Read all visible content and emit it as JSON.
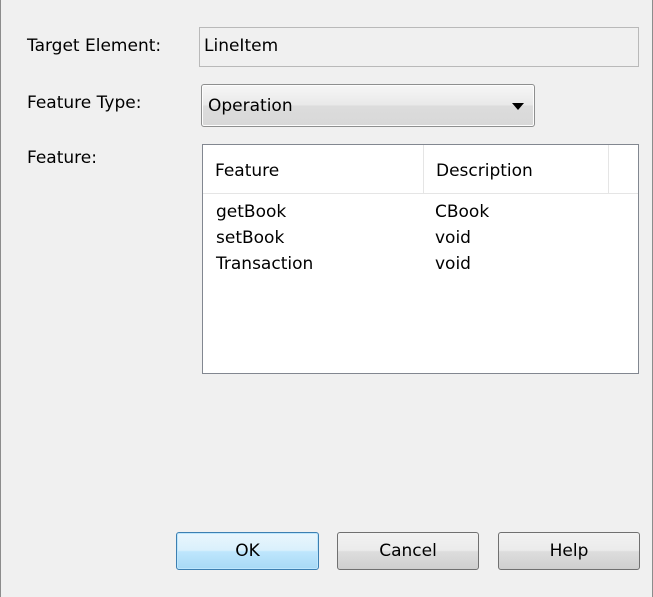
{
  "labels": {
    "target_element": "Target Element:",
    "feature_type": "Feature Type:",
    "feature": "Feature:"
  },
  "target_element_value": "LineItem",
  "feature_type_selected": "Operation",
  "feature_list": {
    "columns": [
      "Feature",
      "Description"
    ],
    "rows": [
      {
        "feature": "getBook",
        "description": "CBook"
      },
      {
        "feature": "setBook",
        "description": "void"
      },
      {
        "feature": "Transaction",
        "description": "void"
      }
    ]
  },
  "buttons": {
    "ok": "OK",
    "cancel": "Cancel",
    "help": "Help"
  }
}
